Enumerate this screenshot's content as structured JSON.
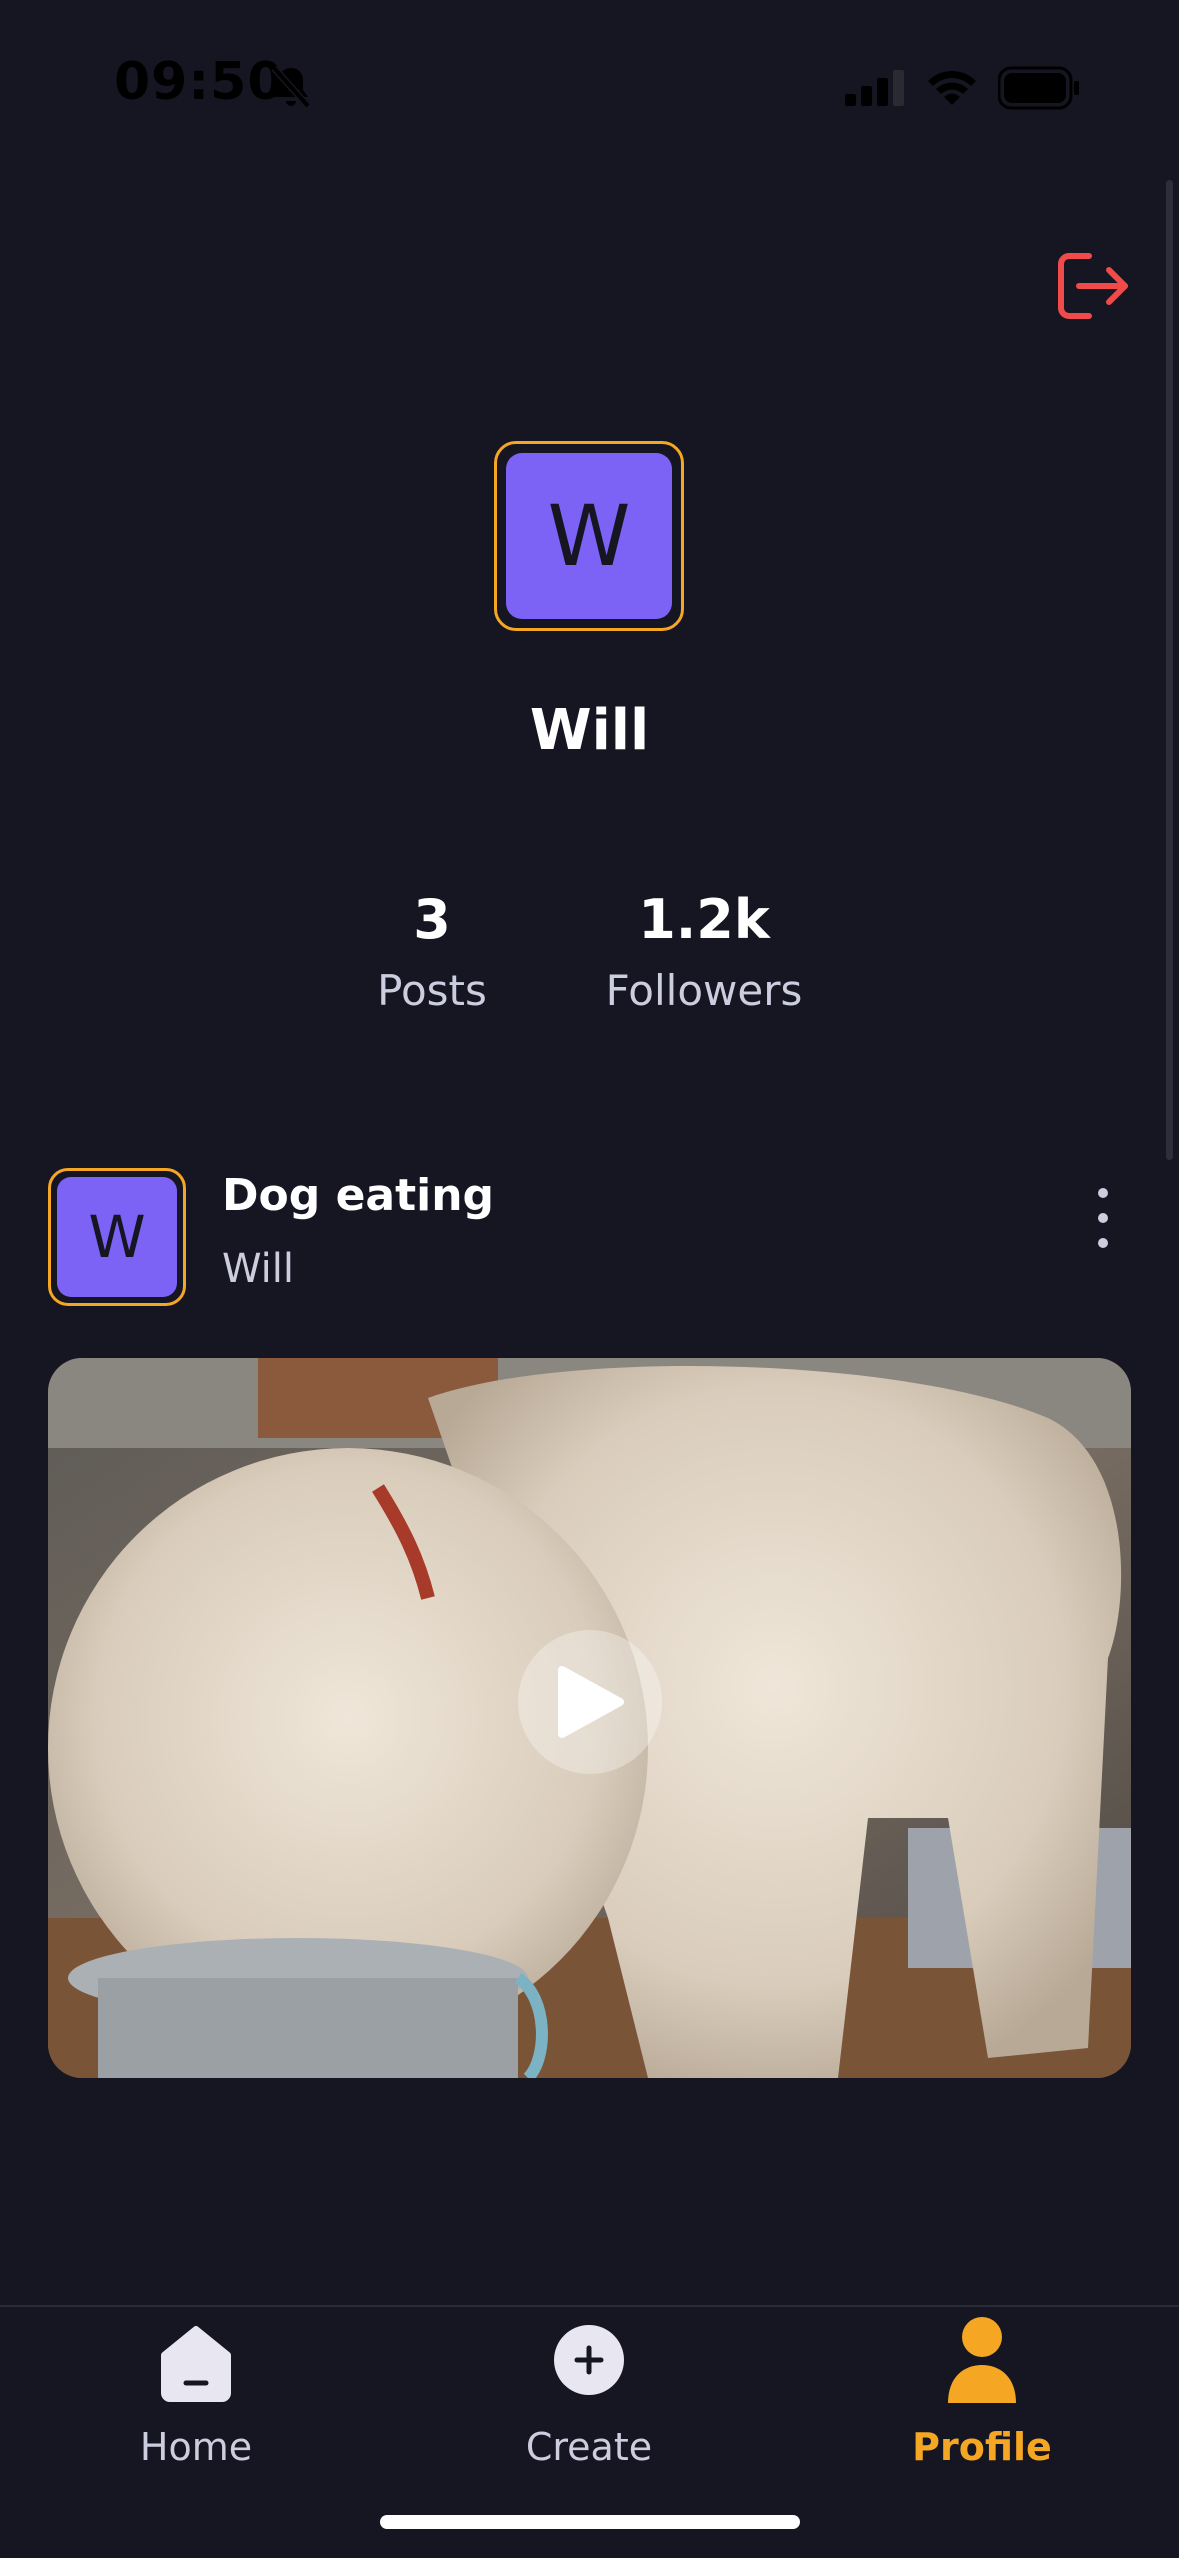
{
  "status_bar": {
    "time": "09:50"
  },
  "profile": {
    "avatar_letter": "W",
    "name": "Will",
    "stats": [
      {
        "value": "3",
        "label": "Posts"
      },
      {
        "value": "1.2k",
        "label": "Followers"
      }
    ]
  },
  "post": {
    "avatar_letter": "W",
    "title": "Dog eating",
    "author": "Will"
  },
  "tab_bar": {
    "tabs": [
      {
        "label": "Home",
        "icon": "home-icon",
        "active": false
      },
      {
        "label": "Create",
        "icon": "plus-icon",
        "active": false
      },
      {
        "label": "Profile",
        "icon": "profile-icon",
        "active": true
      }
    ]
  },
  "colors": {
    "background": "#161622",
    "accent": "#f5a623",
    "avatar": "#7c63f6",
    "logout": "#f04a4a"
  }
}
